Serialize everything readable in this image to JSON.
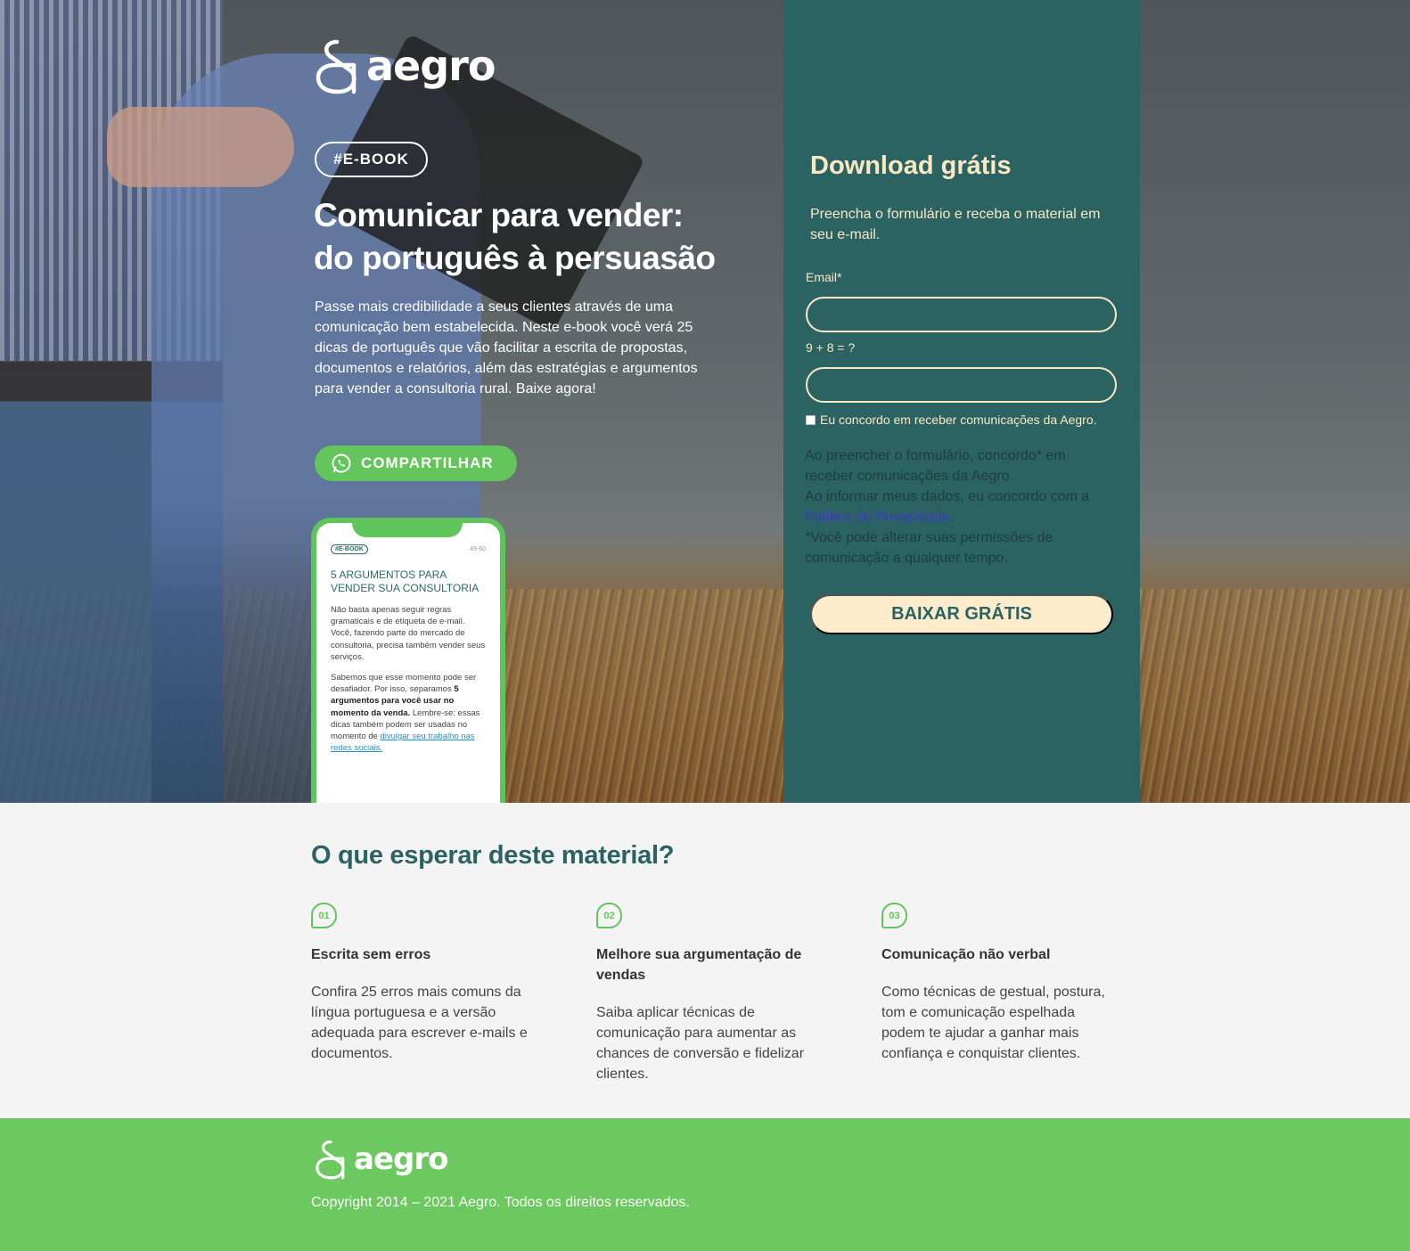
{
  "brand": {
    "name": "aegro",
    "accent": "#63c55c",
    "panel": "#2a6362",
    "cream": "#fbe8c2"
  },
  "hero": {
    "tag": "#E-BOOK",
    "title_lines": [
      "Comunicar para vender:",
      "do português à persuasão"
    ],
    "description": "Passe mais credibilidade a seus clientes através de uma comunicação bem estabelecida. Neste e-book você verá 25 dicas de português que vão facilitar a escrita de propostas, documentos e relatórios, além das estratégias e argumentos para vender a consultoria rural. Baixe agora!",
    "share_label": "COMPARTILHAR",
    "share_icon": "whatsapp-icon"
  },
  "phone_preview": {
    "tag": "#E-BOOK",
    "page": "49-60",
    "title_lines": [
      "5 ARGUMENTOS PARA",
      "VENDER SUA CONSULTORIA"
    ],
    "p1": "Não basta apenas seguir regras gramaticais e de etiqueta de e-mail. Você, fazendo parte do mercado de consultoria, precisa também vender seus serviços.",
    "p2_start": "Sabemos que esse momento pode ser desafiador. Por isso, separamos ",
    "p2_bold": "5 argumentos para você usar no momento da venda.",
    "p2_mid": " Lembre-se: essas dicas também podem ser usadas no momento de ",
    "p2_link": "divulgar seu trabalho nas redes sociais."
  },
  "form": {
    "title": "Download grátis",
    "subtitle": "Preencha o formulário e receba o material em seu e-mail.",
    "email_label": "Email*",
    "email_value": "",
    "captcha_label": "9 + 8 = ?",
    "captcha_value": "",
    "consent_label": "Eu concordo em receber comunicações da Aegro.",
    "legal_1": "Ao preencher o formulário, concordo* em receber comunicações da Aegro.",
    "legal_2_start": "Ao informar meus dados, eu concordo com a ",
    "legal_2_link": "Política de Privacidade",
    "legal_2_end": ".",
    "legal_3": "*Você pode alterar suas permissões de comunicação a qualquer tempo.",
    "submit_label": "BAIXAR GRÁTIS"
  },
  "expect": {
    "title": "O que esperar deste material?",
    "items": [
      {
        "num": "01",
        "title": "Escrita sem erros",
        "text": "Confira 25 erros mais comuns da língua portuguesa e a versão adequada para escrever e-mails e documentos."
      },
      {
        "num": "02",
        "title": "Melhore sua argumentação de vendas",
        "text": "Saiba aplicar técnicas de comunicação para aumentar as chances de conversão e fidelizar clientes."
      },
      {
        "num": "03",
        "title": "Comunicação não verbal",
        "text": "Como técnicas de gestual, postura, tom e comunicação espelhada podem te ajudar a ganhar mais confiança e conquistar clientes."
      }
    ]
  },
  "footer": {
    "copyright": "Copyright 2014 – 2021 Aegro. Todos os direitos reservados."
  }
}
